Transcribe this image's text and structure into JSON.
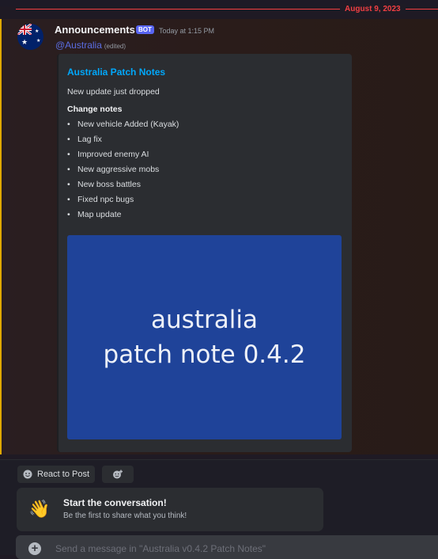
{
  "divider": {
    "date": "August 9, 2023"
  },
  "message": {
    "author": "Announcements",
    "bot_tag": "BOT",
    "timestamp": "Today at 1:15 PM",
    "mention": "@Australia",
    "edited": "(edited)",
    "avatar_icon": "australia-flag-icon"
  },
  "embed": {
    "title": "Australia Patch Notes",
    "description": "New update just dropped",
    "notes_heading": "Change notes",
    "notes": [
      "New vehicle Added (Kayak)",
      "Lag fix",
      "Improved enemy AI",
      "New aggressive mobs",
      "New boss battles",
      "Fixed npc bugs",
      "Map update"
    ],
    "image_text": [
      "australia",
      "patch note 0.4.2"
    ]
  },
  "actions": {
    "react_label": "React to Post",
    "react_icon": "emoji-smile-icon",
    "add_reaction_icon": "add-reaction-icon"
  },
  "prompt_card": {
    "icon": "waving-hand-icon",
    "title": "Start the conversation!",
    "subtitle": "Be the first to share what you think!"
  },
  "composer": {
    "placeholder": "Send a message in \"Australia v0.4.2 Patch Notes\""
  },
  "colors": {
    "accent_red": "#f23f43",
    "link_blue": "#00a8fc",
    "bot_tag": "#5865f2",
    "embed_bg": "#2b2d31",
    "image_bg": "#1f4399"
  }
}
